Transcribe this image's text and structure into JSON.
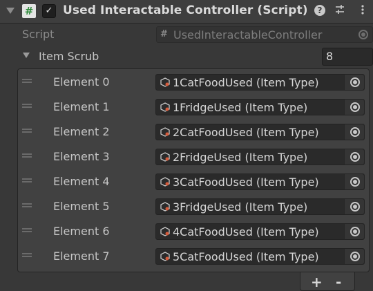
{
  "component": {
    "title": "Used Interactable Controller (Script)",
    "enabled": true,
    "icons": [
      "help-icon",
      "presets-icon",
      "more-options-icon"
    ]
  },
  "script_field": {
    "label": "Script",
    "value": "UsedInteractableController"
  },
  "item_scrub": {
    "label": "Item Scrub",
    "size": "8",
    "elements": [
      {
        "label": "Element 0",
        "value": "1CatFoodUsed (Item Type)"
      },
      {
        "label": "Element 1",
        "value": "1FridgeUsed (Item Type)"
      },
      {
        "label": "Element 2",
        "value": "2CatFoodUsed (Item Type)"
      },
      {
        "label": "Element 3",
        "value": "2FridgeUsed (Item Type)"
      },
      {
        "label": "Element 4",
        "value": "3CatFoodUsed (Item Type)"
      },
      {
        "label": "Element 5",
        "value": "3FridgeUsed (Item Type)"
      },
      {
        "label": "Element 6",
        "value": "4CatFoodUsed (Item Type)"
      },
      {
        "label": "Element 7",
        "value": "5CatFoodUsed (Item Type)"
      }
    ],
    "add_label": "+",
    "remove_label": "-"
  }
}
